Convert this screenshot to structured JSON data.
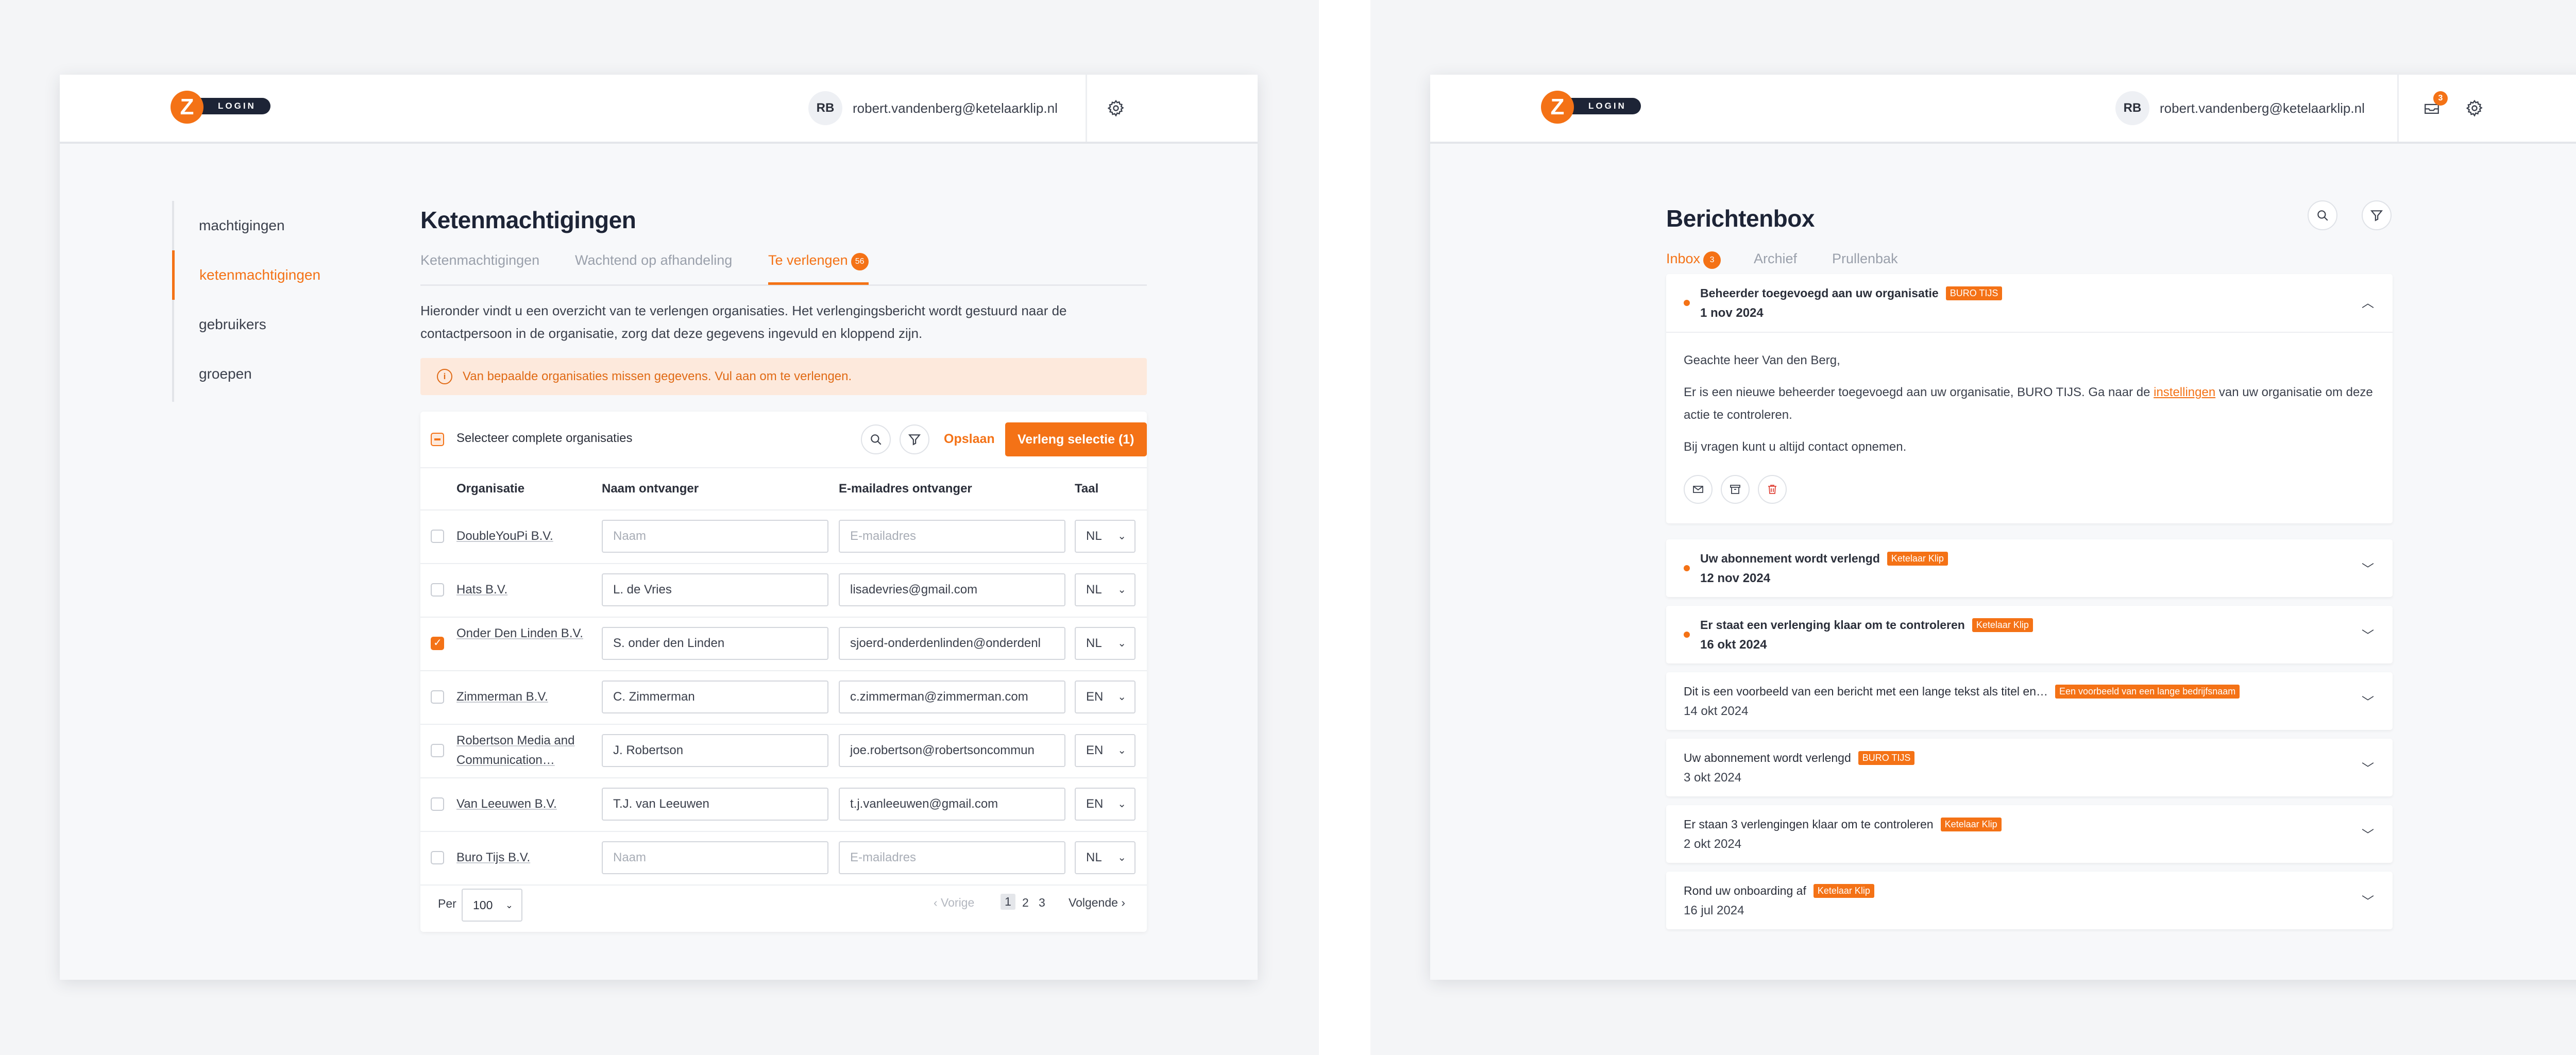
{
  "brand": {
    "logo_letter": "Z",
    "logo_text": "LOGIN"
  },
  "colors": {
    "accent": "#f47216",
    "dark": "#1d2436",
    "alert_bg": "#fde9dc"
  },
  "header": {
    "avatar_initials": "RB",
    "email": "robert.vandenberg@ketelaarklip.nl",
    "settings_icon": "gear-icon",
    "inbox_icon": "mail-icon",
    "inbox_count": "3"
  },
  "sidebar": {
    "items": [
      {
        "label": "machtigingen",
        "active": false
      },
      {
        "label": "ketenmachtigingen",
        "active": true
      },
      {
        "label": "gebruikers",
        "active": false
      },
      {
        "label": "groepen",
        "active": false
      }
    ]
  },
  "chain": {
    "title": "Ketenmachtigingen",
    "tabs": [
      {
        "label": "Ketenmachtigingen"
      },
      {
        "label": "Wachtend op afhandeling"
      },
      {
        "label": "Te verlengen",
        "count": "56"
      }
    ],
    "intro": "Hieronder vindt u een overzicht van te verlengen organisaties. Het verlengingsbericht wordt gestuurd naar de contactpersoon in de organisatie, zorg dat deze gegevens ingevuld en kloppend zijn.",
    "alert": "Van bepaalde organisaties missen gegevens. Vul aan om te verlengen.",
    "select_all_label": "Selecteer complete organisaties",
    "save_label": "Opslaan",
    "renew_label": "Verleng selectie (1)",
    "columns": [
      "Organisatie",
      "Naam ontvanger",
      "E-mailadres ontvanger",
      "Taal"
    ],
    "name_placeholder": "Naam",
    "email_placeholder": "E-mailadres",
    "rows": [
      {
        "org": "DoubleYouPi B.V.",
        "name": "",
        "email": "",
        "lang": "NL",
        "checked": false
      },
      {
        "org": "Hats B.V.",
        "name": "L. de Vries",
        "email": "lisadevries@gmail.com",
        "lang": "NL",
        "checked": false
      },
      {
        "org": "Onder Den Linden B.V.",
        "name": "S. onder den Linden",
        "email": "sjoerd-onderdenlinden@onderdenl",
        "lang": "NL",
        "checked": true
      },
      {
        "org": "Zimmerman B.V.",
        "name": "C. Zimmerman",
        "email": "c.zimmerman@zimmerman.com",
        "lang": "EN",
        "checked": false
      },
      {
        "org": "Robertson Media and Communication…",
        "name": "J. Robertson",
        "email": "joe.robertson@robertsoncommun",
        "lang": "EN",
        "checked": false
      },
      {
        "org": "Van Leeuwen B.V.",
        "name": "T.J. van Leeuwen",
        "email": "t.j.vanleeuwen@gmail.com",
        "lang": "EN",
        "checked": false
      },
      {
        "org": "Buro Tijs B.V.",
        "name": "",
        "email": "",
        "lang": "NL",
        "checked": false
      }
    ],
    "pagination": {
      "per_label": "Per",
      "per_value": "100",
      "prev": "‹ Vorige",
      "pages": [
        "1",
        "2",
        "3"
      ],
      "next": "Volgende ›"
    }
  },
  "inbox": {
    "title": "Berichtenbox",
    "tabs": [
      {
        "label": "Inbox",
        "count": "3"
      },
      {
        "label": "Archief"
      },
      {
        "label": "Prullenbak"
      }
    ],
    "expanded": {
      "title": "Beheerder toegevoegd aan uw organisatie",
      "tag": "BURO TIJS",
      "date": "1 nov 2024",
      "greeting": "Geachte heer Van den Berg,",
      "body_before": "Er is een nieuwe beheerder toegevoegd aan uw organisatie, BURO TIJS. Ga naar de ",
      "body_link": "instellingen",
      "body_after": " van uw organisatie om deze actie te controleren.",
      "closing": "Bij vragen kunt u altijd contact opnemen."
    },
    "messages": [
      {
        "title": "Uw abonnement wordt verlengd",
        "tag": "Ketelaar Klip",
        "date": "12 nov 2024",
        "unread": true
      },
      {
        "title": "Er staat een verlenging klaar om te controleren",
        "tag": "Ketelaar Klip",
        "date": "16 okt 2024",
        "unread": true
      },
      {
        "title": "Dit is een voorbeeld van een bericht met een lange tekst als titel en…",
        "tag": "Een voorbeeld van een lange bedrijfsnaam",
        "date": "14 okt 2024",
        "unread": false
      },
      {
        "title": "Uw abonnement wordt verlengd",
        "tag": "BURO TIJS",
        "date": "3 okt 2024",
        "unread": false
      },
      {
        "title": "Er staan 3 verlengingen klaar om te controleren",
        "tag": "Ketelaar Klip",
        "date": "2 okt 2024",
        "unread": false
      },
      {
        "title": "Rond uw onboarding af",
        "tag": "Ketelaar Klip",
        "date": "16 jul 2024",
        "unread": false
      }
    ]
  }
}
